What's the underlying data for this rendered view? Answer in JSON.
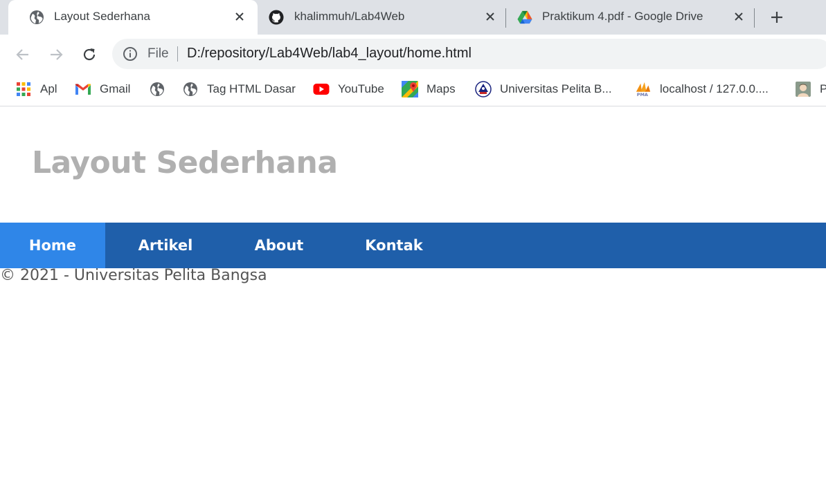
{
  "browser": {
    "tabs": [
      {
        "title": "Layout Sederhana",
        "icon": "globe-icon",
        "active": true
      },
      {
        "title": "khalimmuh/Lab4Web",
        "icon": "github-icon",
        "active": false
      },
      {
        "title": "Praktikum 4.pdf - Google Drive",
        "icon": "google-drive-icon",
        "active": false
      }
    ],
    "close_glyph": "✕",
    "new_tab_glyph": "+"
  },
  "toolbar": {
    "scheme_label": "File",
    "url": "D:/repository/Lab4Web/lab4_layout/home.html"
  },
  "bookmarks": [
    {
      "label": "Apl",
      "icon": "apps-grid-icon"
    },
    {
      "label": "Gmail",
      "icon": "gmail-icon"
    },
    {
      "label": "",
      "icon": "globe-icon"
    },
    {
      "label": "Tag HTML Dasar",
      "icon": "globe-icon"
    },
    {
      "label": "YouTube",
      "icon": "youtube-icon"
    },
    {
      "label": "Maps",
      "icon": "google-maps-icon"
    },
    {
      "label": "Universitas Pelita B...",
      "icon": "university-logo-icon"
    },
    {
      "label": "localhost / 127.0.0....",
      "icon": "phpmyadmin-icon"
    },
    {
      "label": "P",
      "icon": "portrait-icon"
    }
  ],
  "page": {
    "title": "Layout Sederhana",
    "nav": [
      {
        "label": "Home",
        "active": true
      },
      {
        "label": "Artikel",
        "active": false
      },
      {
        "label": "About",
        "active": false
      },
      {
        "label": "Kontak",
        "active": false
      }
    ],
    "footer": "© 2021 - Universitas Pelita Bangsa"
  },
  "colors": {
    "tabstrip_bg": "#dee1e6",
    "nav_bg": "#1f5faa",
    "nav_active_bg": "#2f86e8",
    "title_color": "#b0b0b0"
  }
}
